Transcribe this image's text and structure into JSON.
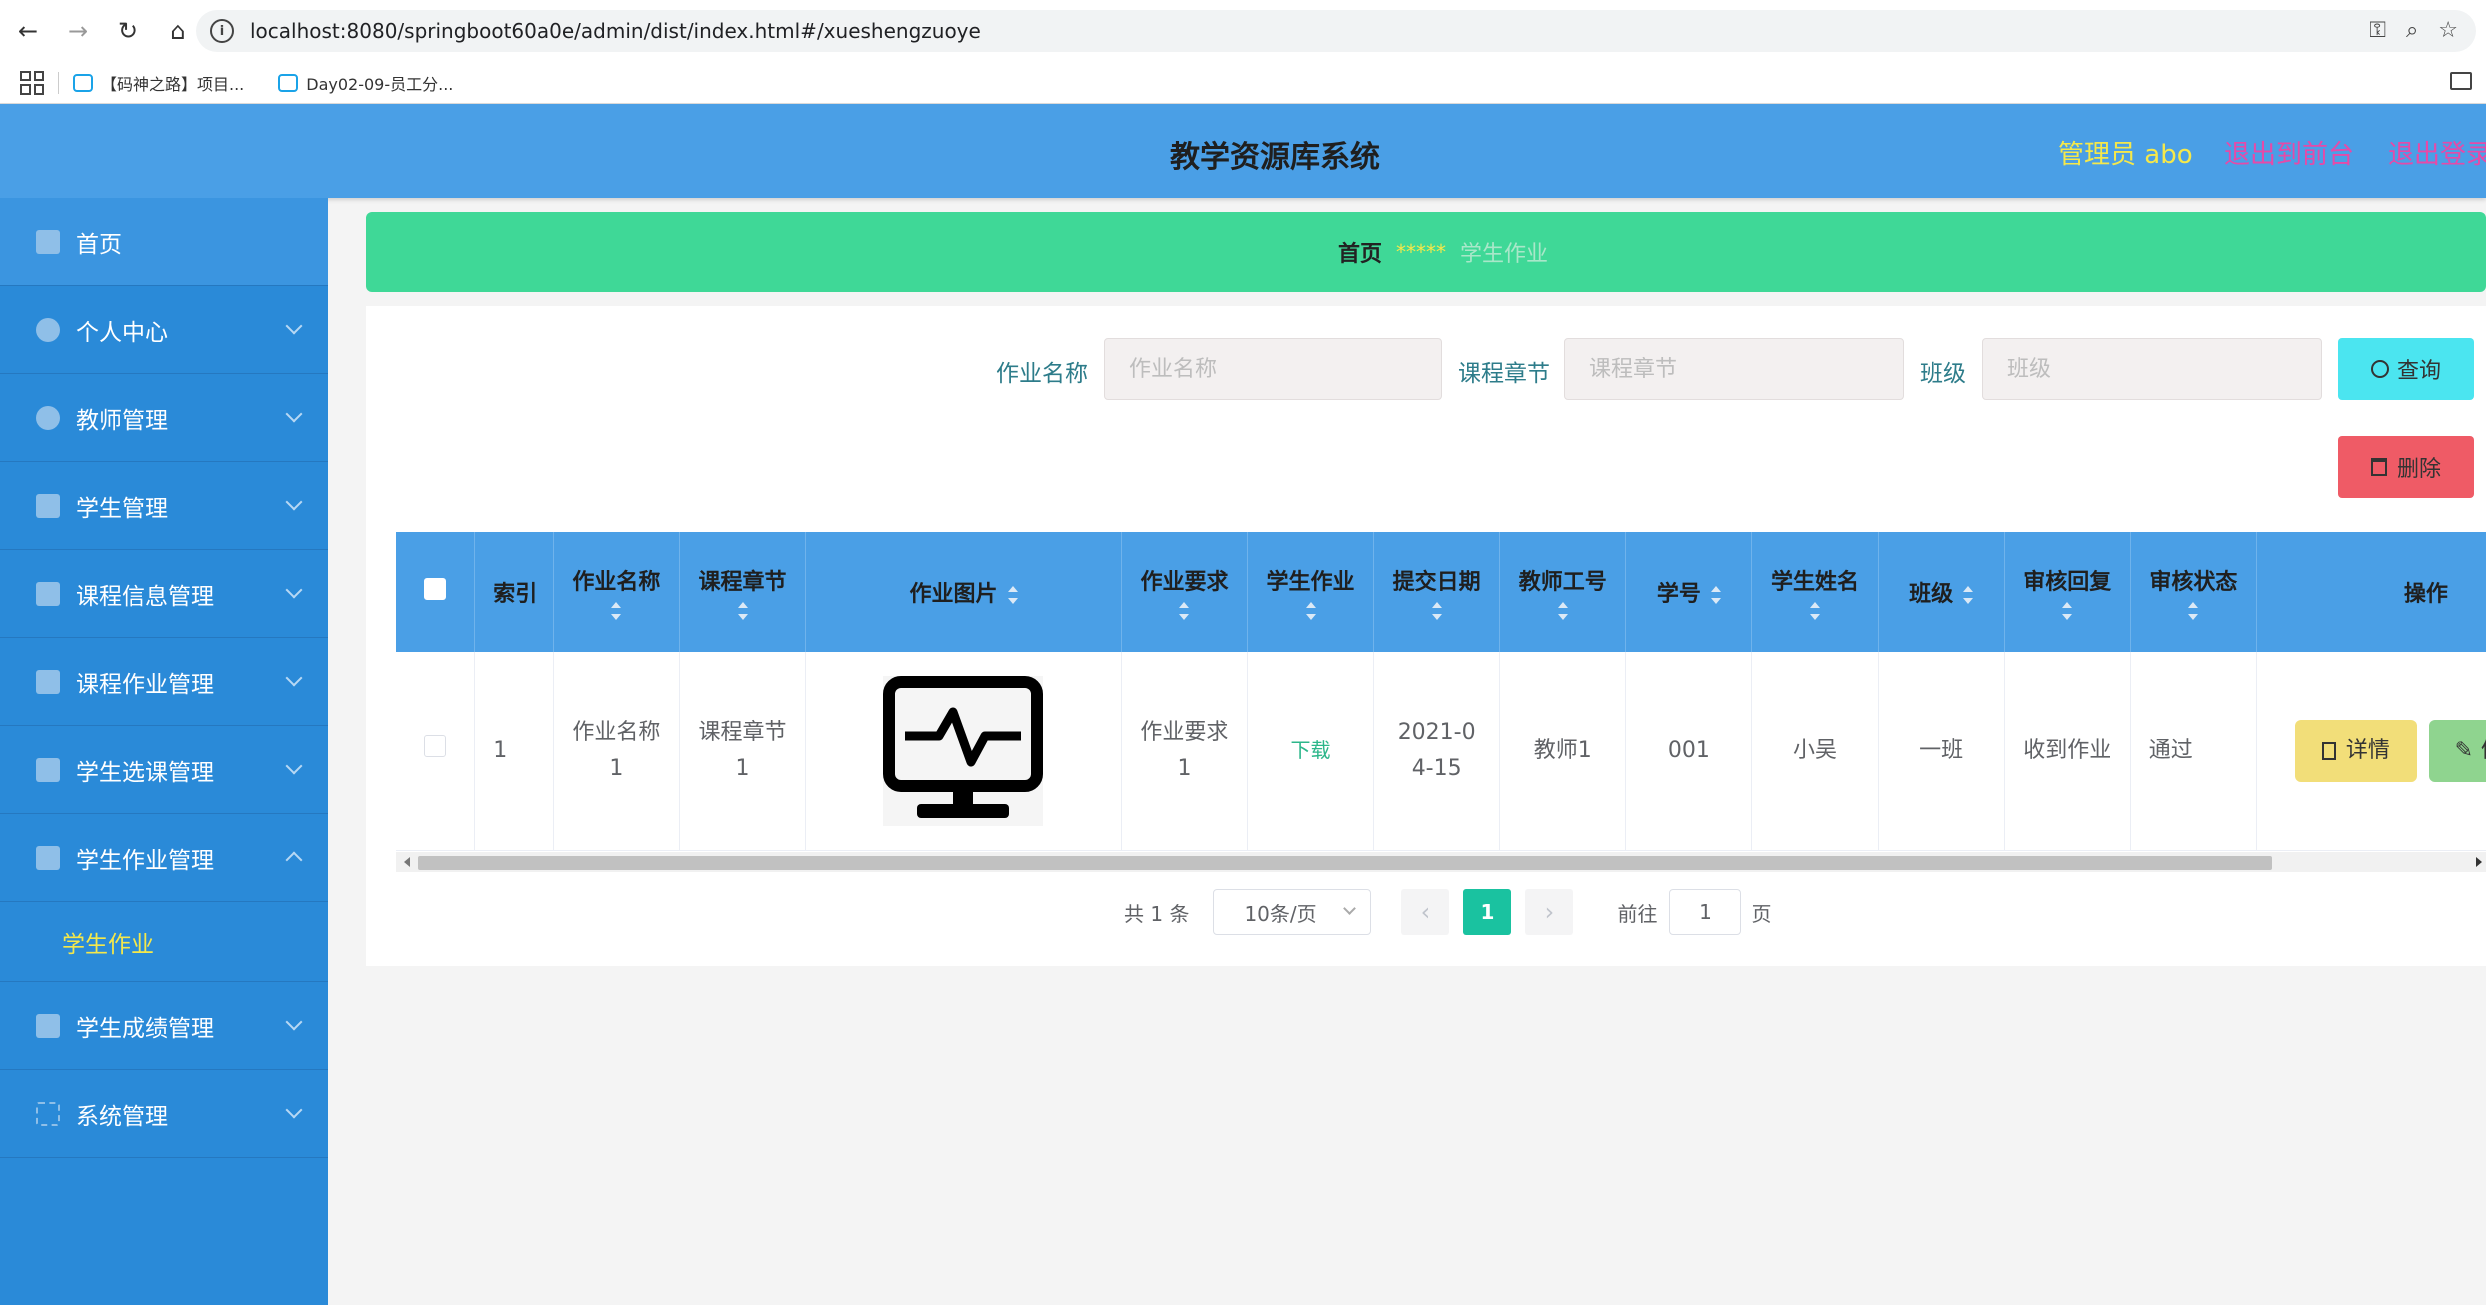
{
  "browser": {
    "url": "localhost:8080/springboot60a0e/admin/dist/index.html#/xueshengzuoye",
    "bookmarks": [
      {
        "label": "【码神之路】项目..."
      },
      {
        "label": "Day02-09-员工分..."
      }
    ]
  },
  "header": {
    "title": "教学资源库系统",
    "admin": "管理员 abo",
    "back_front": "退出到前台",
    "logout": "退出登录"
  },
  "sidebar": {
    "items": [
      {
        "label": "首页"
      },
      {
        "label": "个人中心"
      },
      {
        "label": "教师管理"
      },
      {
        "label": "学生管理"
      },
      {
        "label": "课程信息管理"
      },
      {
        "label": "课程作业管理"
      },
      {
        "label": "学生选课管理"
      },
      {
        "label": "学生作业管理"
      },
      {
        "label": "学生成绩管理"
      },
      {
        "label": "系统管理"
      }
    ],
    "submenu_active": "学生作业"
  },
  "breadcrumb": {
    "home": "首页",
    "separator": "*****",
    "current": "学生作业"
  },
  "search": {
    "name_label": "作业名称",
    "name_placeholder": "作业名称",
    "chapter_label": "课程章节",
    "chapter_placeholder": "课程章节",
    "class_label": "班级",
    "class_placeholder": "班级",
    "query_button": "查询",
    "delete_button": "删除"
  },
  "table": {
    "columns": [
      "索引",
      "作业名称",
      "课程章节",
      "作业图片",
      "作业要求",
      "学生作业",
      "提交日期",
      "教师工号",
      "学号",
      "学生姓名",
      "班级",
      "审核回复",
      "审核状态",
      "操作"
    ],
    "rows": [
      {
        "index": "1",
        "name": "作业名称1",
        "chapter": "课程章节1",
        "image": "monitor-heartbeat-icon",
        "requirement": "作业要求1",
        "student_work": "下载",
        "date": "2021-04-15",
        "teacher_id": "教师1",
        "student_no": "001",
        "student_name": "小吴",
        "class": "一班",
        "reply": "收到作业",
        "status": "通过",
        "detail_button": "详情",
        "edit_button": "修改"
      }
    ]
  },
  "pagination": {
    "total": "共 1 条",
    "page_size": "10条/页",
    "current_page": "1",
    "goto_prefix": "前往",
    "goto_value": "1",
    "goto_suffix": "页"
  }
}
